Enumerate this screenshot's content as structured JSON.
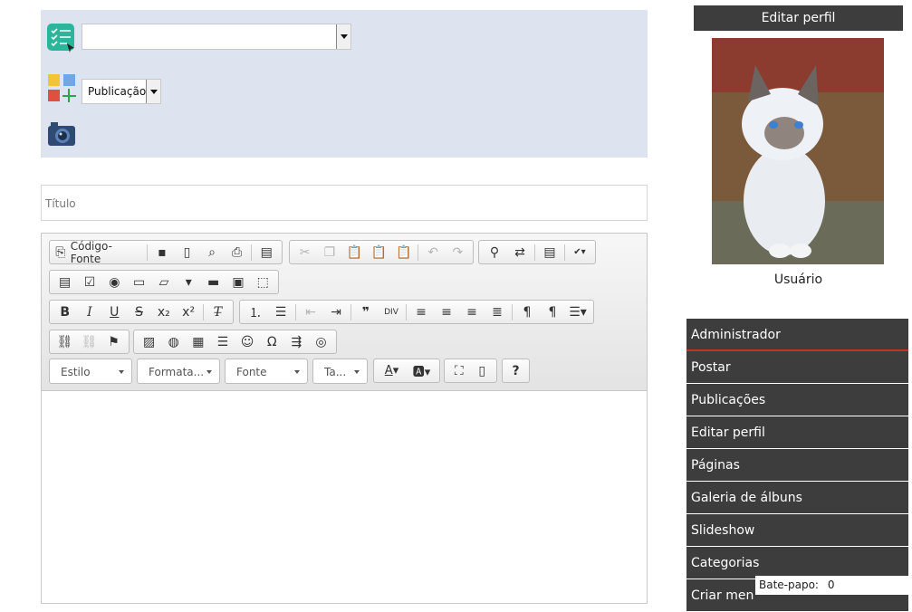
{
  "post_form": {
    "category_value": "",
    "type_value": "Publicação",
    "title_placeholder": "Título"
  },
  "editor": {
    "source_label": "Código-Fonte",
    "style_combo": "Estilo",
    "format_combo": "Formata...",
    "font_combo": "Fonte",
    "size_combo": "Ta...",
    "help_label": "?"
  },
  "profile": {
    "header": "Editar perfil",
    "user_label": "Usuário"
  },
  "menu": {
    "items": [
      {
        "label": "Administrador"
      },
      {
        "label": "Postar"
      },
      {
        "label": "Publicações"
      },
      {
        "label": "Editar perfil"
      },
      {
        "label": "Páginas"
      },
      {
        "label": "Galeria de álbuns"
      },
      {
        "label": "Slideshow"
      },
      {
        "label": "Categorias"
      },
      {
        "label": "Criar men"
      }
    ]
  },
  "chat": {
    "label": "Bate-papo:",
    "count": "0"
  },
  "colors": {
    "panel_bg": "#dde3ef",
    "menu_bg": "#3d3d3d",
    "menu_active_underline": "#c8302a",
    "checklist_icon": "#2bb59a"
  }
}
